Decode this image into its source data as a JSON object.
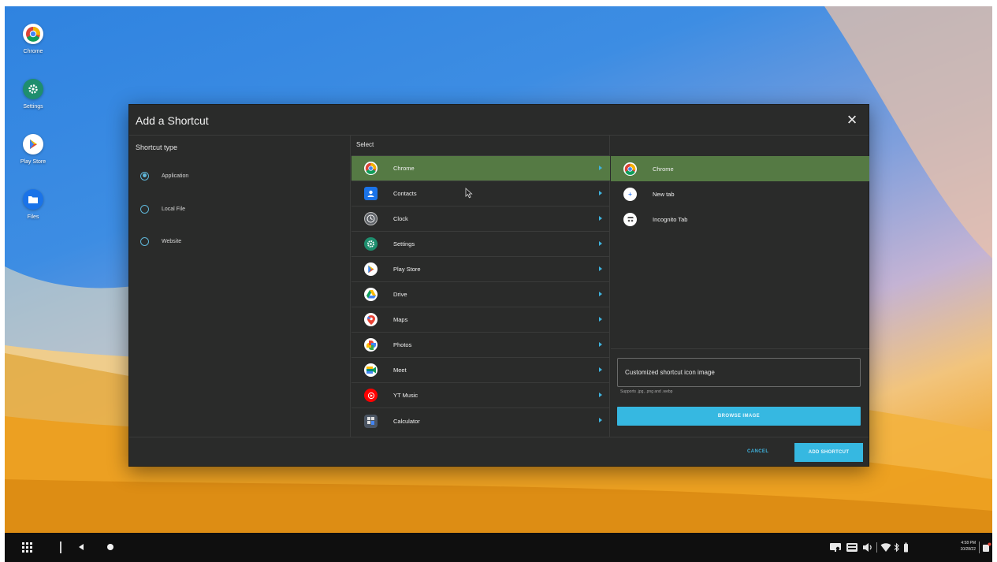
{
  "desktop": {
    "icons": [
      {
        "label": "Chrome",
        "icon": "chrome-icon"
      },
      {
        "label": "Settings",
        "icon": "settings-gear-icon"
      },
      {
        "label": "Play Store",
        "icon": "play-store-icon"
      },
      {
        "label": "Files",
        "icon": "folder-icon"
      }
    ]
  },
  "dialog": {
    "title": "Add a Shortcut",
    "close_icon": "close-icon",
    "shortcut_type": {
      "label": "Shortcut type",
      "options": [
        "Application",
        "Local File",
        "Website"
      ],
      "selected": "Application"
    },
    "select_label": "Select",
    "apps": [
      {
        "label": "Chrome",
        "icon": "chrome-icon",
        "color": "#ffffff"
      },
      {
        "label": "Contacts",
        "icon": "contacts-icon",
        "color": "#1a73e8"
      },
      {
        "label": "Clock",
        "icon": "clock-icon",
        "color": "#5f6368"
      },
      {
        "label": "Settings",
        "icon": "settings-gear-icon",
        "color": "#1e8e6e"
      },
      {
        "label": "Play Store",
        "icon": "play-store-icon",
        "color": "#ffffff"
      },
      {
        "label": "Drive",
        "icon": "drive-icon",
        "color": "#ffffff"
      },
      {
        "label": "Maps",
        "icon": "maps-icon",
        "color": "#ffffff"
      },
      {
        "label": "Photos",
        "icon": "photos-icon",
        "color": "#ffffff"
      },
      {
        "label": "Meet",
        "icon": "meet-icon",
        "color": "#ffffff"
      },
      {
        "label": "YT Music",
        "icon": "yt-music-icon",
        "color": "#ff0000"
      },
      {
        "label": "Calculator",
        "icon": "calculator-icon",
        "color": "#4b5563"
      }
    ],
    "selected_app": "Chrome",
    "sub_items": [
      {
        "label": "Chrome",
        "icon": "chrome-icon"
      },
      {
        "label": "New tab",
        "icon": "plus-icon"
      },
      {
        "label": "Incognito Tab",
        "icon": "incognito-icon"
      }
    ],
    "selected_sub_item": "Chrome",
    "custom_icon_field": "Customized shortcut icon image",
    "custom_icon_hint": "Supports .jpg, .png and .webp",
    "browse_button": "BROWSE IMAGE",
    "cancel_button": "CANCEL",
    "add_button": "ADD SHORTCUT"
  },
  "taskbar": {
    "time": "4:58 PM",
    "date": "10/28/22"
  },
  "colors": {
    "accent": "#36b8e1",
    "selected_row": "#557a44",
    "dialog_bg": "#2a2b2a"
  }
}
